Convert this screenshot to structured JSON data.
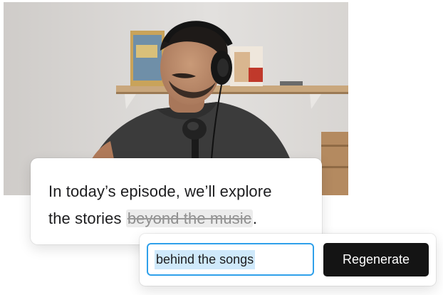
{
  "photo": {
    "subject": "podcast-host-with-headphones-and-microphone"
  },
  "transcript": {
    "line1": "In today’s episode, we’ll explore",
    "line2_prefix": "the stories ",
    "struck_text": "beyond the music",
    "line2_suffix": "."
  },
  "editor": {
    "input_value": "behind the songs",
    "button_label": "Regenerate"
  },
  "colors": {
    "input_border": "#2fa0ea",
    "selection_highlight": "#cfe9fb",
    "button_bg": "#141414",
    "button_text": "#ffffff"
  }
}
